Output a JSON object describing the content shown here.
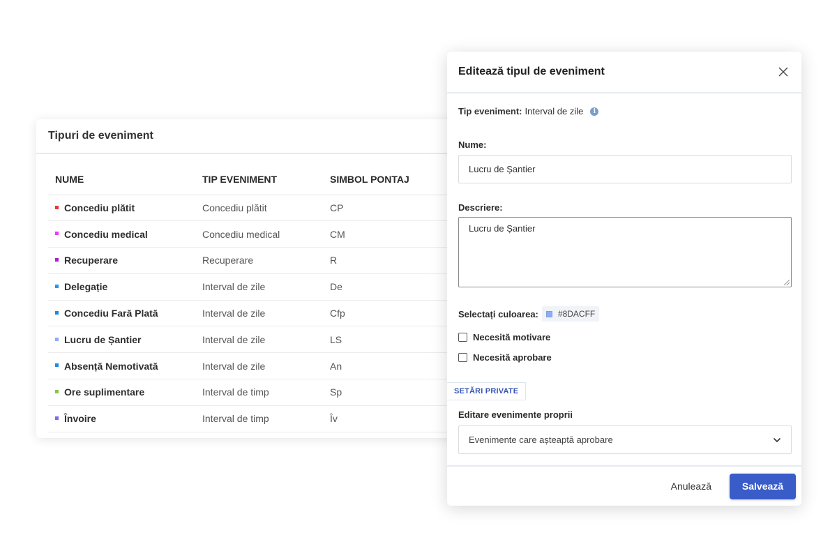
{
  "table": {
    "title": "Tipuri de eveniment",
    "columns": [
      "NUME",
      "TIP EVENIMENT",
      "SIMBOL PONTAJ"
    ],
    "rows": [
      {
        "name": "Concediu plătit",
        "type": "Concediu plătit",
        "symbol": "CP",
        "color": "#e53935"
      },
      {
        "name": "Concediu medical",
        "type": "Concediu medical",
        "symbol": "CM",
        "color": "#e040fb"
      },
      {
        "name": "Recuperare",
        "type": "Recuperare",
        "symbol": "R",
        "color": "#ab20c8"
      },
      {
        "name": "Delegație",
        "type": "Interval de zile",
        "symbol": "De",
        "color": "#2196f3"
      },
      {
        "name": "Concediu Fară Plată",
        "type": "Interval de zile",
        "symbol": "Cfp",
        "color": "#1e88e5"
      },
      {
        "name": "Lucru de Șantier",
        "type": "Interval de zile",
        "symbol": "LS",
        "color": "#8DACFF"
      },
      {
        "name": "Absență Nemotivată",
        "type": "Interval de zile",
        "symbol": "An",
        "color": "#1e88e5"
      },
      {
        "name": "Ore suplimentare",
        "type": "Interval de timp",
        "symbol": "Sp",
        "color": "#8bc34a"
      },
      {
        "name": "Învoire",
        "type": "Interval de timp",
        "symbol": "Îv",
        "color": "#7c6cf0"
      }
    ]
  },
  "modal": {
    "title": "Editează tipul de eveniment",
    "close_icon": "close-icon",
    "type_label": "Tip eveniment:",
    "type_value": "Interval de zile",
    "name_label": "Nume:",
    "name_value": "Lucru de Șantier",
    "description_label": "Descriere:",
    "description_value": "Lucru de Șantier",
    "color_label": "Selectați culoarea:",
    "color_value": "#8DACFF",
    "checkbox_motivation": {
      "label": "Necesită motivare",
      "checked": false
    },
    "checkbox_approval": {
      "label": "Necesită aprobare",
      "checked": false
    },
    "private_settings_label": "SETĂRI PRIVATE",
    "edit_own_label": "Editare evenimente proprii",
    "edit_own_value": "Evenimente care așteaptă aprobare",
    "cancel_label": "Anulează",
    "save_label": "Salvează",
    "accent_color": "#3a5cc8"
  }
}
